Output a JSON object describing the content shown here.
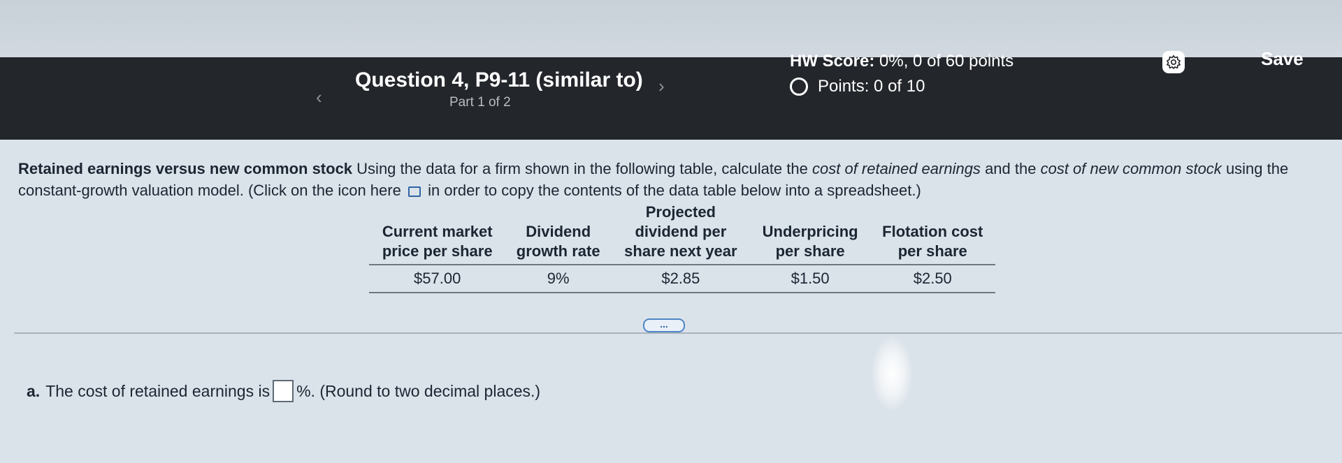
{
  "header": {
    "question_title": "Question 4, P9-11 (similar to)",
    "part": "Part 1 of 2",
    "hw_score_label": "HW Score:",
    "hw_score_value": "0%, 0 of 60 points",
    "points_label": "Points:",
    "points_value": "0 of 10",
    "save_label": "Save",
    "prev_icon": "chevron-left-icon",
    "next_icon": "chevron-right-icon",
    "settings_icon": "gear-icon"
  },
  "problem": {
    "title": "Retained earnings versus new common stock",
    "text1": "Using the data for a firm shown in the following table, calculate the",
    "term1": "cost of retained earnings",
    "and": "and the",
    "term2": "cost of new common stock",
    "text2": "using the constant-growth valuation model. (Click on the icon here",
    "text3": "in order to copy the contents of the data table below into a spreadsheet.)"
  },
  "table": {
    "headers": [
      "Current market\nprice per share",
      "Dividend\ngrowth rate",
      "Projected\ndividend per\nshare next year",
      "Underpricing\nper share",
      "Flotation cost\nper share"
    ],
    "row": [
      "$57.00",
      "9%",
      "$2.85",
      "$1.50",
      "$2.50"
    ]
  },
  "more_button": "...",
  "question_a": {
    "letter": "a.",
    "text_before": "The cost of retained earnings is",
    "text_after": "%. (Round to two decimal places.)",
    "answer_value": ""
  },
  "colors": {
    "header_bg": "#23262b",
    "content_bg": "#dbe3ea",
    "accent": "#2f63a5"
  }
}
